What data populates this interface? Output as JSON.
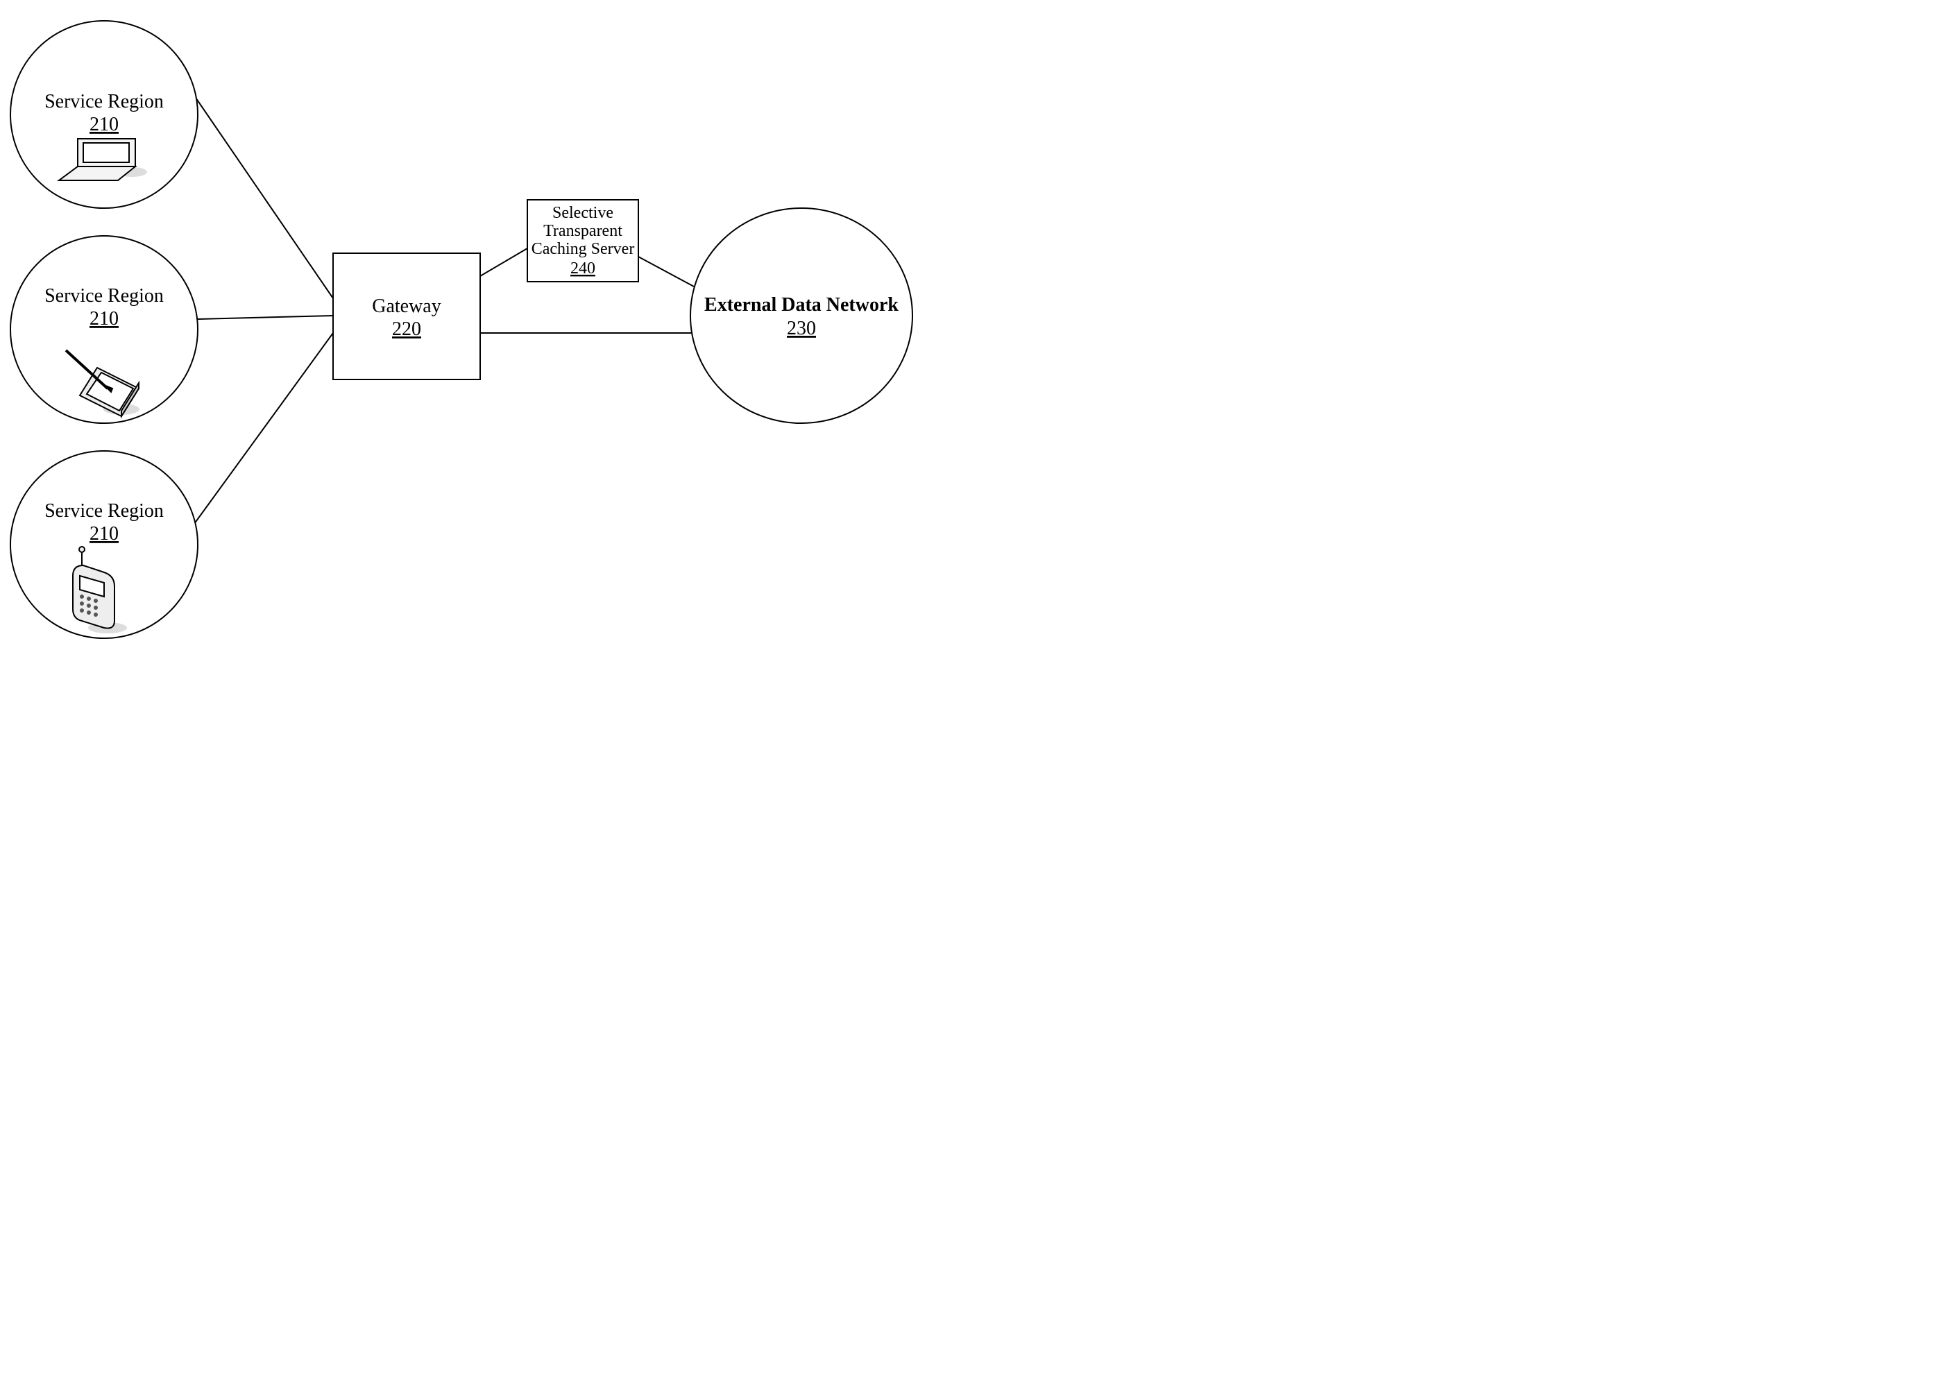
{
  "nodes": {
    "serviceRegion1": {
      "label": "Service Region",
      "num": "210"
    },
    "serviceRegion2": {
      "label": "Service Region",
      "num": "210"
    },
    "serviceRegion3": {
      "label": "Service Region",
      "num": "210"
    },
    "gateway": {
      "label": "Gateway",
      "num": "220"
    },
    "cache": {
      "label1": "Selective",
      "label2": "Transparent",
      "label3": "Caching Server",
      "num": "240"
    },
    "external": {
      "label": "External Data Network",
      "num": "230"
    }
  }
}
